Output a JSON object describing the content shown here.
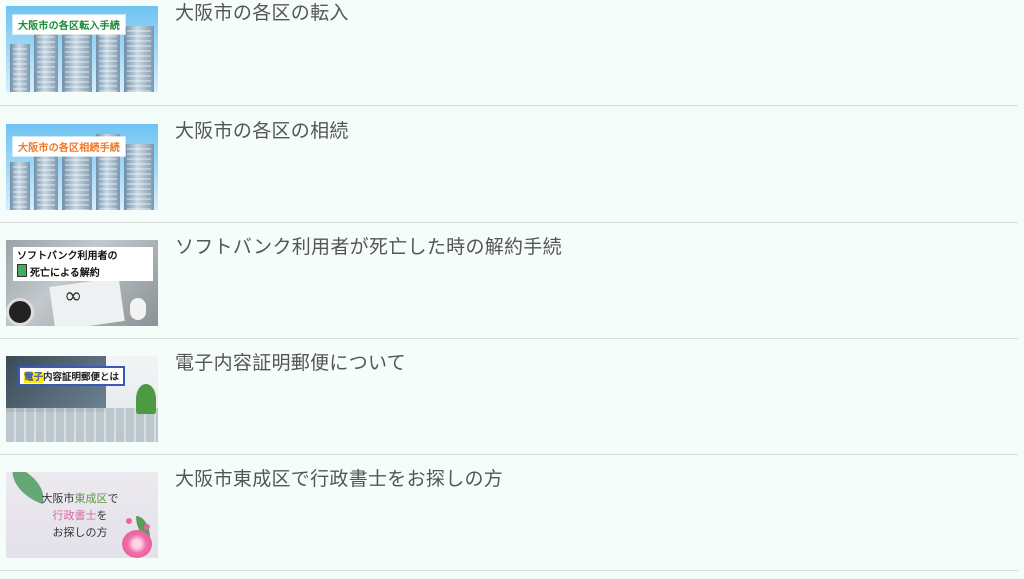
{
  "items": [
    {
      "title": "大阪市の各区の転入",
      "thumb_text": "大阪市の各区転入手続",
      "thumb_icon": "city-skyline-image",
      "accent": "#1a8a35"
    },
    {
      "title": "大阪市の各区の相続",
      "thumb_text": "大阪市の各区相続手続",
      "thumb_icon": "city-skyline-image",
      "accent": "#f0782a"
    },
    {
      "title": "ソフトバンク利用者が死亡した時の解約手続",
      "thumb_text_line1": "ソフトバンク利用者の",
      "thumb_text_line2": "死亡による解約",
      "thumb_icon": "desk-glasses-image"
    },
    {
      "title": "電子内容証明郵便について",
      "thumb_text_highlight": "電子",
      "thumb_text_rest": "内容証明郵便とは",
      "thumb_icon": "laptop-image"
    },
    {
      "title": "大阪市東成区で行政書士をお探しの方",
      "thumb_line1_a": "大阪市",
      "thumb_line1_b": "東成区",
      "thumb_line1_c": "で",
      "thumb_line2_a": "行政書士",
      "thumb_line2_b": "を",
      "thumb_line3": "お探しの方",
      "thumb_icon": "flower-image"
    }
  ],
  "colors": {
    "background": "#f5fdfa",
    "title_text": "#555555",
    "divider": "#d6dbda"
  }
}
